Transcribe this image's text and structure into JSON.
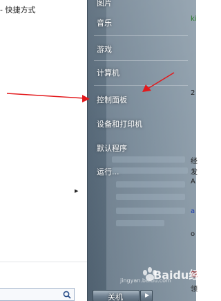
{
  "left": {
    "top_text": "- 快捷方式"
  },
  "menu": {
    "partial_top": "图片",
    "items": [
      {
        "name": "music",
        "label": "音乐"
      },
      {
        "name": "games",
        "label": "游戏"
      },
      {
        "name": "computer",
        "label": "计算机"
      },
      {
        "name": "control-panel",
        "label": "控制面板"
      },
      {
        "name": "devices-printers",
        "label": "设备和打印机"
      },
      {
        "name": "default-programs",
        "label": "默认程序"
      },
      {
        "name": "run",
        "label": "运行..."
      }
    ]
  },
  "edge": {
    "chars": [
      "ki",
      "2",
      "经",
      "发",
      "A",
      "a",
      "o",
      "载",
      "领"
    ]
  },
  "shutdown": {
    "label": "关机",
    "arrow": "▶"
  },
  "watermark": {
    "text": "Baidu经验",
    "url": "jingyan.baidu.com"
  },
  "colors": {
    "annotation_red": "#e3191c",
    "glass_panel": "#6a7d8c"
  }
}
